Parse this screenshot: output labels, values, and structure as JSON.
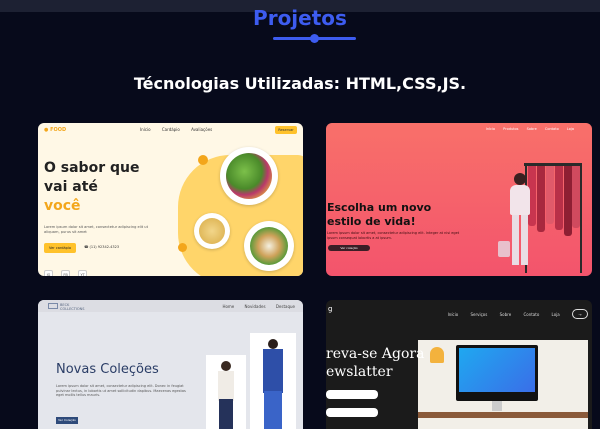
{
  "section": {
    "title": "Projetos",
    "subtitle": "Técnologias Utilizadas: HTML,CSS,JS."
  },
  "colors": {
    "accent": "#3d5cf0",
    "background": "#070a1b"
  },
  "projects": [
    {
      "name": "food",
      "logo": "FOOD",
      "nav": [
        "Início",
        "Cardápio",
        "Avaliações"
      ],
      "nav_button": "Reservar",
      "headline_l1": "O sabor que",
      "headline_l2": "vai até",
      "headline_accent": "você",
      "description": "Lorem ipsum dolor sit amet, consectetur adipiscing elit ut aliquam, purus sit amet",
      "cta": "Ver cardápio",
      "phone": "(11) 92342-4323",
      "socials": [
        "IG",
        "FB",
        "YT"
      ]
    },
    {
      "name": "fashion",
      "nav": [
        "Início",
        "Produtos",
        "Sobre",
        "Contato",
        "Loja"
      ],
      "headline_l1": "Escolha um novo",
      "headline_l2": "estilo de vida!",
      "description": "Lorem ipsum dolor sit amet, consectetur adipiscing elit. Integer at nisi eget ipsum consequat lobortis a at ipsum.",
      "button": "Ver coleção"
    },
    {
      "name": "collections",
      "logo": "BECK",
      "logo_sub": "COLLECTIONS",
      "nav": [
        "Home",
        "Novidades",
        "Destaque"
      ],
      "headline": "Novas Coleções",
      "description": "Lorem ipsum dolor sit amet, consectetur adipiscing elit. Donec in feugiat pulvinar lectus, in lobortis ut amet sollicitudin dapibus. Maecenas egestas eget mollis tellus mauris.",
      "button": "Ver Coleção"
    },
    {
      "name": "newsletter",
      "logo": "g",
      "nav": [
        "Início",
        "Serviços",
        "Sobre",
        "Contato",
        "Loja"
      ],
      "headline_l1": "reva-se Agora",
      "headline_l2": "ewslatter"
    }
  ]
}
